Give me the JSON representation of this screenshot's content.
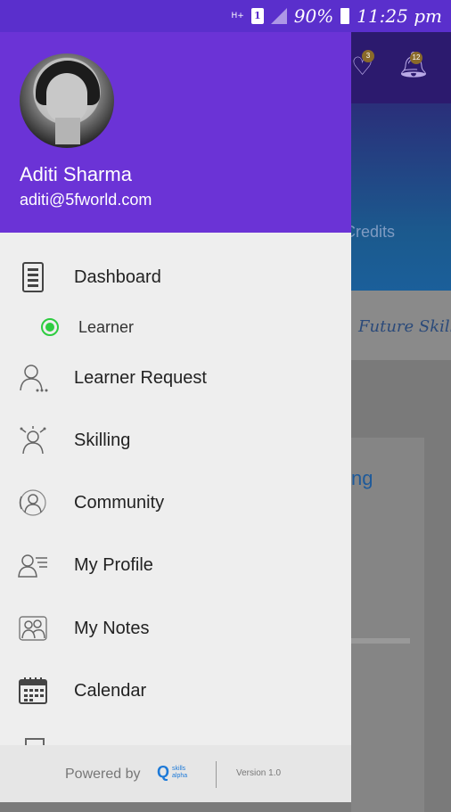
{
  "status_bar": {
    "network": "H+",
    "sim": "1",
    "battery": "90%",
    "time": "11:25 pm"
  },
  "background": {
    "heart_badge": "3",
    "bell_badge": "12",
    "credits_text": "Credits",
    "future_skill_text": "Future Skill",
    "card_title_fragment": "ng"
  },
  "drawer": {
    "user": {
      "name": "Aditi Sharma",
      "email": "aditi@5fworld.com"
    },
    "menu": [
      {
        "label": "Dashboard",
        "icon": "dashboard-icon"
      },
      {
        "label": "Learner Request",
        "icon": "learner-request-icon"
      },
      {
        "label": "Skilling",
        "icon": "skilling-icon"
      },
      {
        "label": "Community",
        "icon": "community-icon"
      },
      {
        "label": "My Profile",
        "icon": "profile-icon"
      },
      {
        "label": "My Notes",
        "icon": "notes-icon"
      },
      {
        "label": "Calendar",
        "icon": "calendar-icon"
      }
    ],
    "sub_item": {
      "label": "Learner",
      "selected": true
    },
    "footer": {
      "powered_by": "Powered by",
      "logo_mark": "Q",
      "logo_text_1": "skills",
      "logo_text_2": "alpha",
      "version": "Version 1.0"
    },
    "colors": {
      "header": "#6b33d6",
      "radio": "#2ecc40",
      "background": "#eeeeee"
    }
  }
}
